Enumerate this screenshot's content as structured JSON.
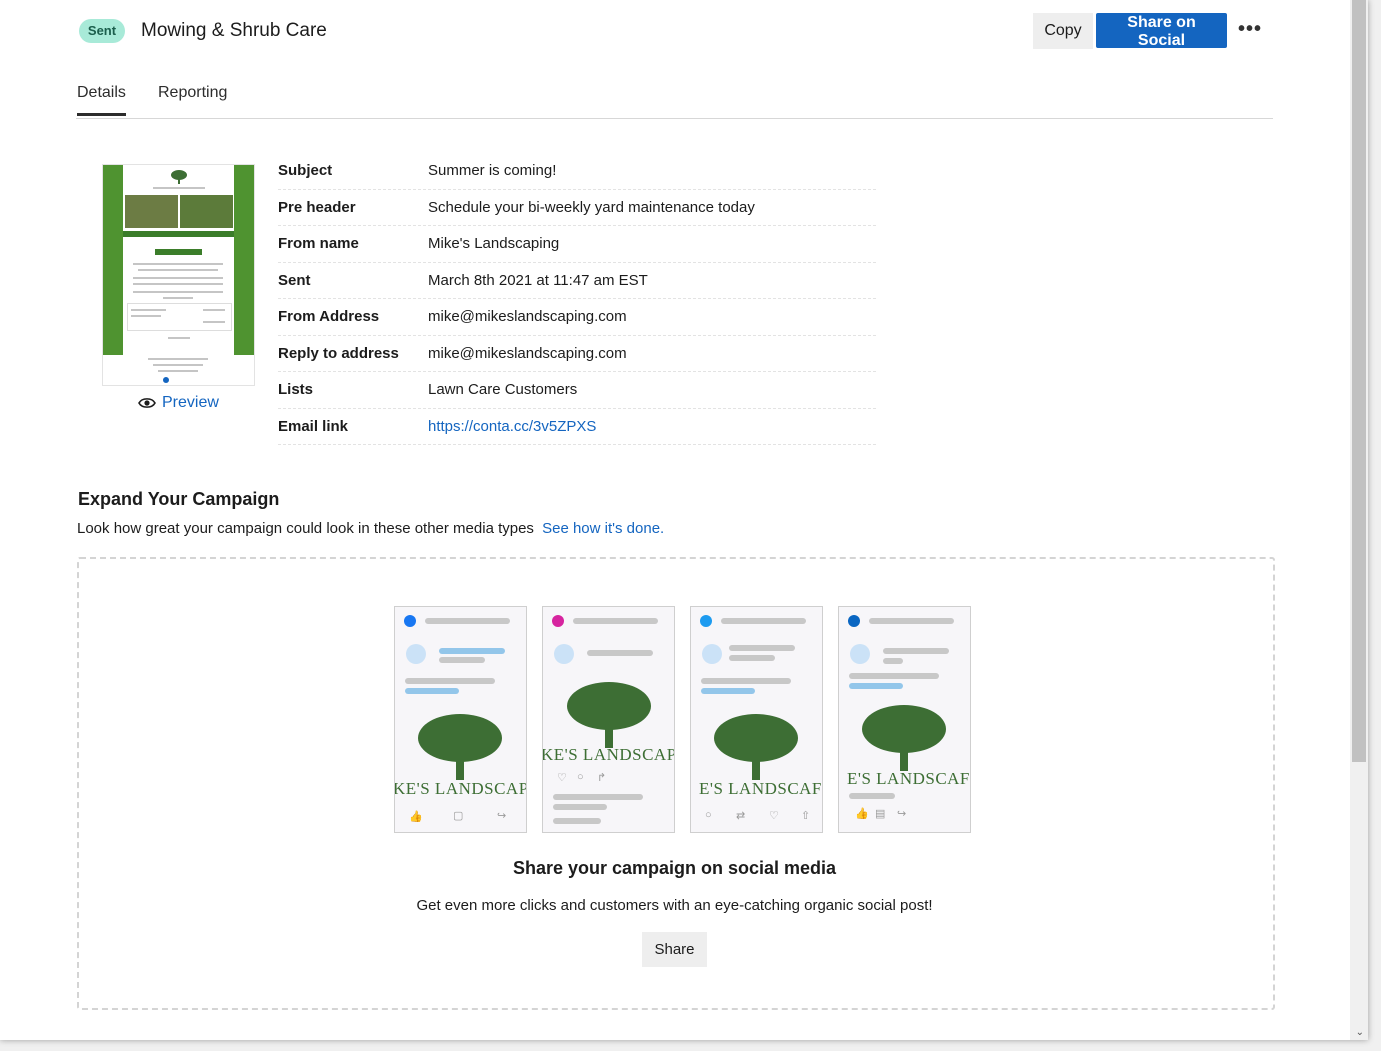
{
  "header": {
    "status_badge": "Sent",
    "title": "Mowing & Shrub Care",
    "copy_label": "Copy",
    "share_social_label": "Share on Social",
    "more_label": "•••"
  },
  "tabs": [
    {
      "label": "Details",
      "active": true
    },
    {
      "label": "Reporting",
      "active": false
    }
  ],
  "preview": {
    "label": "Preview",
    "icon": "eye-icon"
  },
  "details": [
    {
      "label": "Subject",
      "value": "Summer is coming!"
    },
    {
      "label": "Pre header",
      "value": "Schedule your bi-weekly yard maintenance today"
    },
    {
      "label": "From name",
      "value": "Mike's Landscaping"
    },
    {
      "label": "Sent",
      "value": "March 8th 2021 at 11:47 am EST"
    },
    {
      "label": "From Address",
      "value": "mike@mikeslandscaping.com"
    },
    {
      "label": "Reply to address",
      "value": "mike@mikeslandscaping.com"
    },
    {
      "label": "Lists",
      "value": "Lawn Care Customers"
    },
    {
      "label": "Email link",
      "value": "https://conta.cc/3v5ZPXS"
    }
  ],
  "expand": {
    "title": "Expand Your Campaign",
    "subtitle": "Look how great your campaign could look in these other media types",
    "link": "See how it's done."
  },
  "social_cards": [
    {
      "network": "facebook-icon",
      "color": "#1877f2",
      "brand_text": "KE'S LANDSCAPI"
    },
    {
      "network": "instagram-icon",
      "color": "#d6249f",
      "brand_text": "KE'S LANDSCAPI"
    },
    {
      "network": "twitter-icon",
      "color": "#1d9bf0",
      "brand_text": "E'S LANDSCAF"
    },
    {
      "network": "linkedin-icon",
      "color": "#0a66c2",
      "brand_text": "E'S LANDSCAF"
    }
  ],
  "share_panel": {
    "title": "Share your campaign on social media",
    "subtitle": "Get even more clicks and customers with an eye-catching organic social post!",
    "button": "Share"
  },
  "colors": {
    "accent": "#1465c0",
    "badge_bg": "#a8ead8",
    "tree_green": "#3d6e34"
  }
}
